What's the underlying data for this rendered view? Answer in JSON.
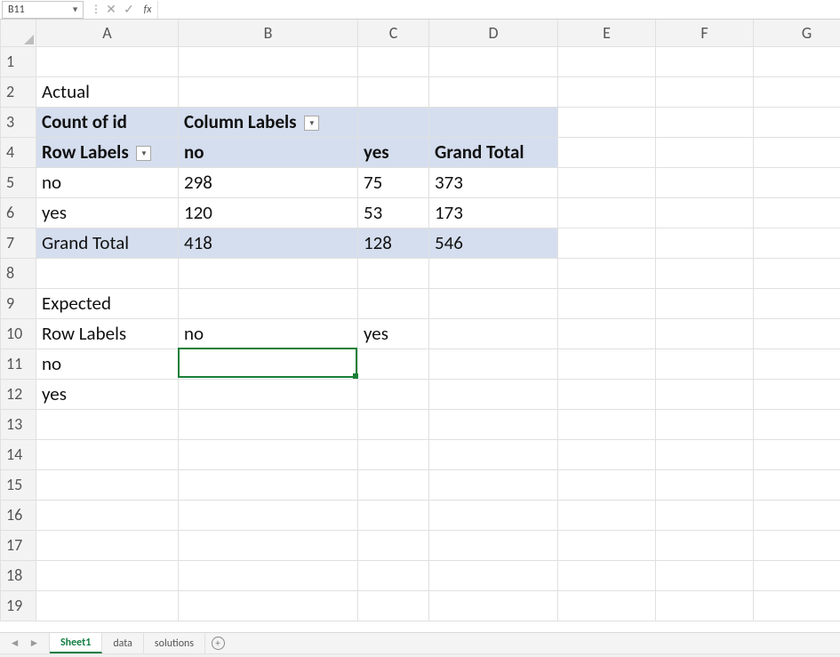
{
  "formula_bar": {
    "name_box": "B11",
    "cancel_glyph": "✕",
    "enter_glyph": "✓",
    "fx_label": "fx",
    "formula_value": ""
  },
  "columns": [
    "A",
    "B",
    "C",
    "D",
    "E",
    "F",
    "G"
  ],
  "rows": [
    "1",
    "2",
    "3",
    "4",
    "5",
    "6",
    "7",
    "8",
    "9",
    "10",
    "11",
    "12",
    "13",
    "14",
    "15",
    "16",
    "17",
    "18",
    "19"
  ],
  "cells": {
    "r2": {
      "A": "Actual"
    },
    "r3": {
      "A": "Count of id",
      "B": "Column Labels"
    },
    "r4": {
      "A": "Row Labels",
      "B": "no",
      "C": "yes",
      "D": "Grand Total"
    },
    "r5": {
      "A": "no",
      "B": "298",
      "C": "75",
      "D": "373"
    },
    "r6": {
      "A": "yes",
      "B": "120",
      "C": "53",
      "D": "173"
    },
    "r7": {
      "A": "Grand Total",
      "B": "418",
      "C": "128",
      "D": "546"
    },
    "r9": {
      "A": "Expected"
    },
    "r10": {
      "A": "Row Labels",
      "B": "no",
      "C": "yes"
    },
    "r11": {
      "A": "no"
    },
    "r12": {
      "A": "yes"
    }
  },
  "tabs": {
    "items": [
      "Sheet1",
      "data",
      "solutions"
    ],
    "active": "Sheet1"
  }
}
